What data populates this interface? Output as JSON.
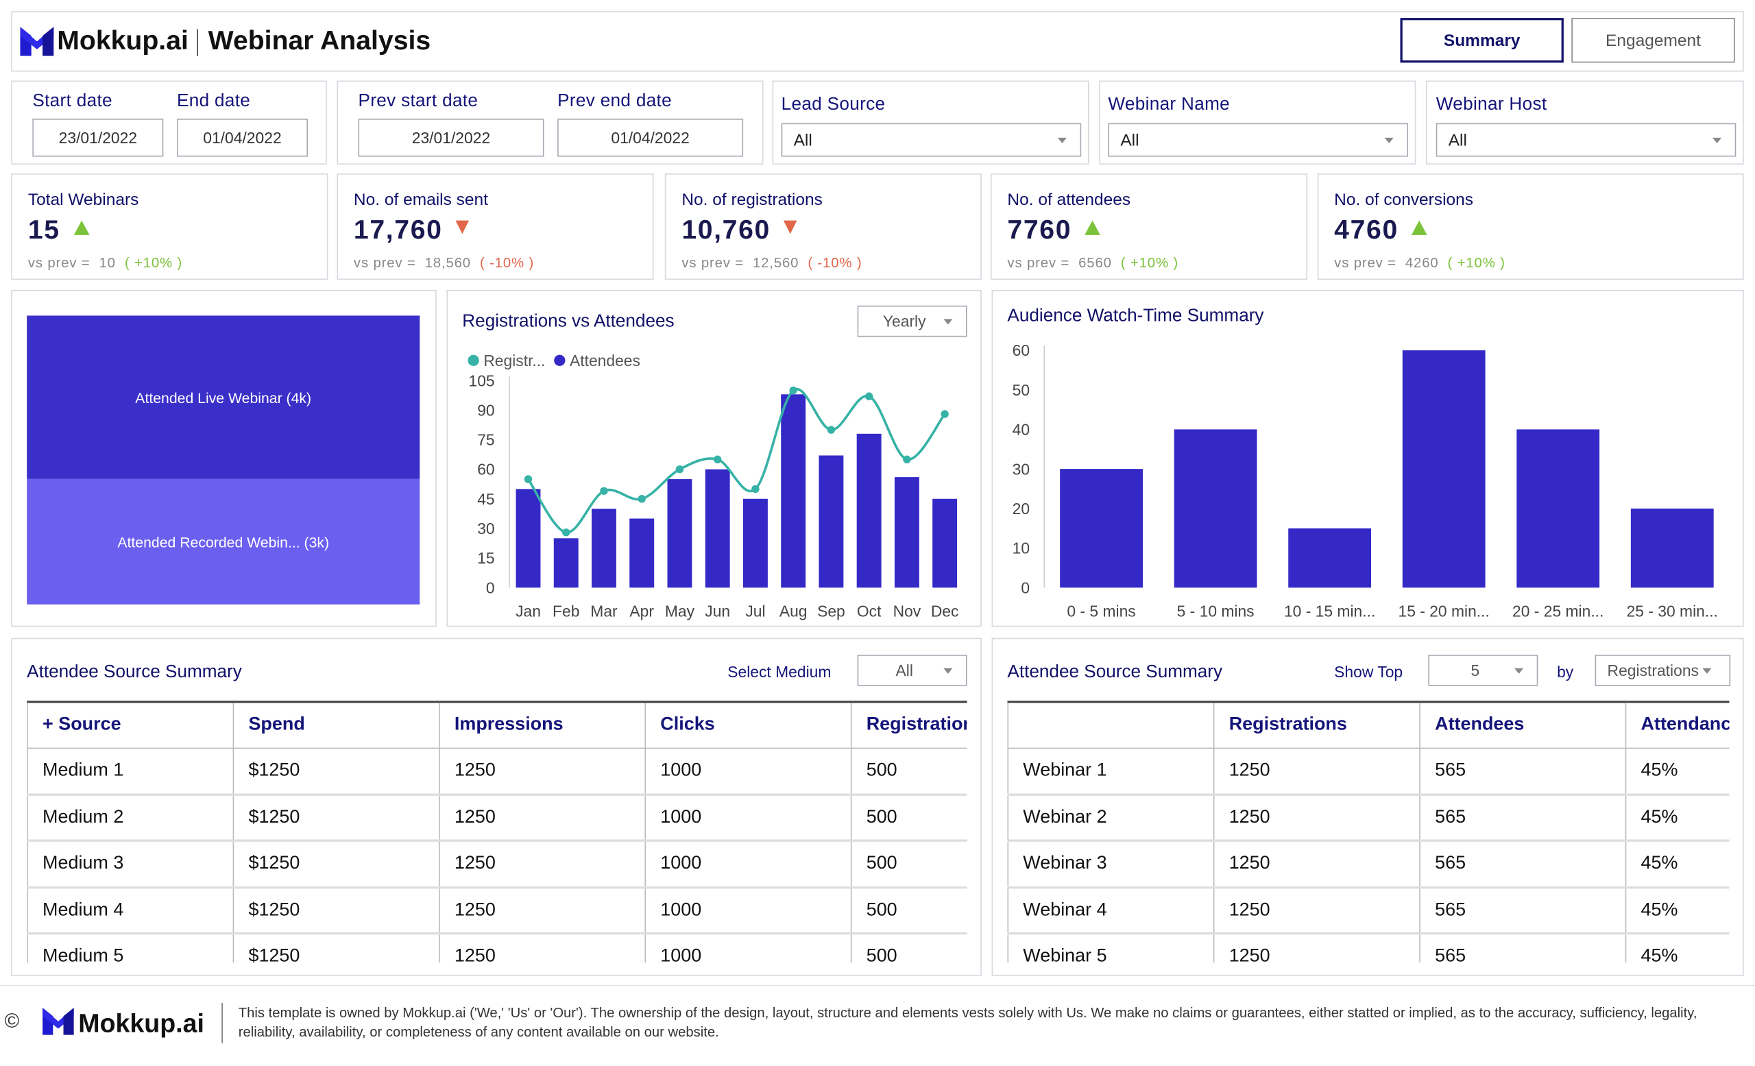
{
  "header": {
    "brand": "Mokkup.ai",
    "title": "Webinar Analysis",
    "tabs": [
      {
        "label": "Summary",
        "active": true
      },
      {
        "label": "Engagement",
        "active": false
      }
    ]
  },
  "filters": {
    "start_date_label": "Start date",
    "start_date": "23/01/2022",
    "end_date_label": "End date",
    "end_date": "01/04/2022",
    "prev_start_label": "Prev start date",
    "prev_start": "23/01/2022",
    "prev_end_label": "Prev end date",
    "prev_end": "01/04/2022",
    "lead_source_label": "Lead Source",
    "lead_source": "All",
    "webinar_name_label": "Webinar Name",
    "webinar_name": "All",
    "webinar_host_label": "Webinar Host",
    "webinar_host": "All"
  },
  "kpis": [
    {
      "title": "Total Webinars",
      "value": "15",
      "trend": "up",
      "prev_label": "vs prev =",
      "prev": "10",
      "delta": "( +10% )"
    },
    {
      "title": "No. of emails sent",
      "value": "17,760",
      "trend": "down",
      "prev_label": "vs prev =",
      "prev": "18,560",
      "delta": "( -10% )"
    },
    {
      "title": "No. of registrations",
      "value": "10,760",
      "trend": "down",
      "prev_label": "vs prev =",
      "prev": "12,560",
      "delta": "( -10% )"
    },
    {
      "title": "No. of attendees",
      "value": "7760",
      "trend": "up",
      "prev_label": "vs prev =",
      "prev": "6560",
      "delta": "( +10% )"
    },
    {
      "title": "No. of conversions",
      "value": "4760",
      "trend": "up",
      "prev_label": "vs prev =",
      "prev": "4260",
      "delta": "( +10% )"
    }
  ],
  "treemap": {
    "items": [
      {
        "label": "Attended Live Webinar (4k)",
        "value": 4,
        "color": "#3b2fc9"
      },
      {
        "label": "Attended Recorded Webin... (3k)",
        "value": 3,
        "color": "#6b5ff0"
      }
    ]
  },
  "reg_chart": {
    "title": "Registrations vs Attendees",
    "period": "Yearly",
    "legend": [
      "Registr...",
      "Attendees"
    ],
    "colors": {
      "registrations": "#36b2a6",
      "attendees": "#3429c7"
    }
  },
  "watch_chart": {
    "title": "Audience Watch-Time Summary",
    "color": "#3429c7"
  },
  "chart_data": [
    {
      "type": "bar",
      "title": "Registrations vs Attendees",
      "categories": [
        "Jan",
        "Feb",
        "Mar",
        "Apr",
        "May",
        "Jun",
        "Jul",
        "Aug",
        "Sep",
        "Oct",
        "Nov",
        "Dec"
      ],
      "series": [
        {
          "name": "Attendees",
          "type": "bar",
          "values": [
            50,
            25,
            40,
            35,
            55,
            60,
            45,
            98,
            67,
            78,
            56,
            45
          ]
        },
        {
          "name": "Registr...",
          "type": "line",
          "values": [
            55,
            28,
            49,
            45,
            60,
            65,
            50,
            100,
            80,
            97,
            65,
            88
          ]
        }
      ],
      "ylim": [
        0,
        105
      ],
      "yticks": [
        0,
        15,
        30,
        45,
        60,
        75,
        90,
        105
      ],
      "legend": "top-left"
    },
    {
      "type": "bar",
      "title": "Audience Watch-Time Summary",
      "categories": [
        "0 - 5 mins",
        "5 - 10 mins",
        "10 - 15 min...",
        "15 - 20 min...",
        "20 - 25 min...",
        "25 - 30 min..."
      ],
      "values": [
        30,
        40,
        15,
        60,
        40,
        20
      ],
      "ylim": [
        0,
        60
      ],
      "yticks": [
        0,
        10,
        20,
        30,
        40,
        50,
        60
      ]
    }
  ],
  "source_table": {
    "title": "Attendee Source Summary",
    "medium_label": "Select Medium",
    "medium_value": "All",
    "columns": [
      "+ Source",
      "Spend",
      "Impressions",
      "Clicks",
      "Registratior"
    ],
    "rows": [
      [
        "Medium 1",
        "$1250",
        "1250",
        "1000",
        "500"
      ],
      [
        "Medium 2",
        "$1250",
        "1250",
        "1000",
        "500"
      ],
      [
        "Medium 3",
        "$1250",
        "1250",
        "1000",
        "500"
      ],
      [
        "Medium 4",
        "$1250",
        "1250",
        "1000",
        "500"
      ],
      [
        "Medium 5",
        "$1250",
        "1250",
        "1000",
        "500"
      ]
    ]
  },
  "webinar_table": {
    "title": "Attendee Source Summary",
    "show_top_label": "Show Top",
    "show_top_value": "5",
    "by_label": "by",
    "by_value": "Registrations",
    "columns": [
      "",
      "Registrations",
      "Attendees",
      "Attendanc"
    ],
    "rows": [
      [
        "Webinar 1",
        "1250",
        "565",
        "45%"
      ],
      [
        "Webinar 2",
        "1250",
        "565",
        "45%"
      ],
      [
        "Webinar 3",
        "1250",
        "565",
        "45%"
      ],
      [
        "Webinar 4",
        "1250",
        "565",
        "45%"
      ],
      [
        "Webinar 5",
        "1250",
        "565",
        "45%"
      ]
    ]
  },
  "footer": {
    "copyright": "©",
    "brand": "Mokkup.ai",
    "disclaimer": "This template is owned by Mokkup.ai ('We,' 'Us' or 'Our'). The ownership of the design, layout, structure and elements vests solely with Us. We make no claims or guarantees, either statted or implied, as to the accuracy, sufficiency, legality, reliability, availability, or completeness of any content available on our website."
  }
}
